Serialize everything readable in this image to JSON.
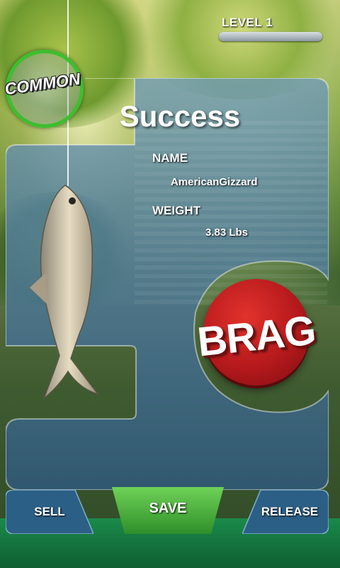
{
  "hud": {
    "level_label": "LEVEL 1",
    "level_progress": 0.0
  },
  "badge": {
    "rarity": "COMMON"
  },
  "result": {
    "title": "Success",
    "name_label": "NAME",
    "name_value": "AmericanGizzard",
    "weight_label": "WEIGHT",
    "weight_value": "3.83 Lbs"
  },
  "brag": {
    "label": "BRAG"
  },
  "actions": {
    "sell": "SELL",
    "save": "SAVE",
    "release": "RELEASE"
  },
  "colors": {
    "panel": "#3e6b8c",
    "save_green": "#47b53a",
    "brag_red": "#c4201f",
    "badge_ring": "#3bbf2e"
  }
}
